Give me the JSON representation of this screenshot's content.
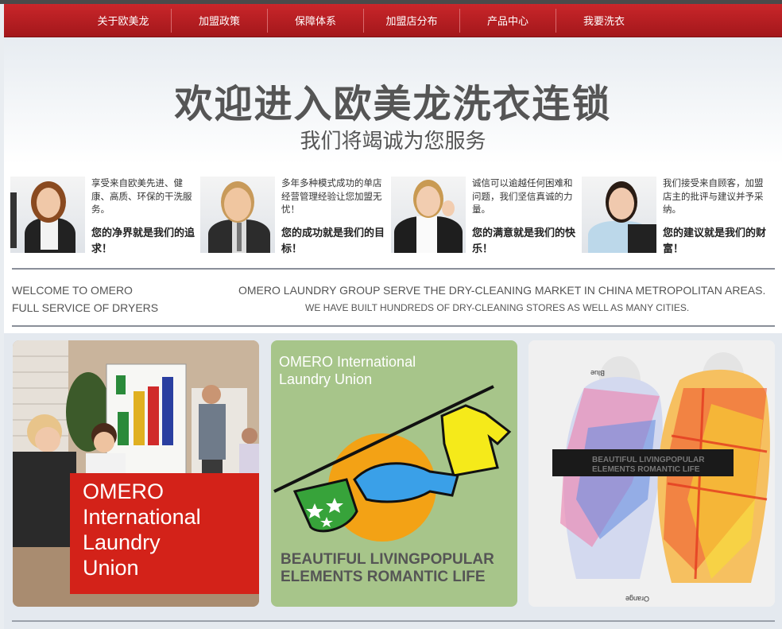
{
  "nav": {
    "items": [
      {
        "label": "关于欧美龙"
      },
      {
        "label": "加盟政策"
      },
      {
        "label": "保障体系"
      },
      {
        "label": "加盟店分布"
      },
      {
        "label": "产品中心"
      },
      {
        "label": "我要洗衣"
      }
    ],
    "color": "#b51e22"
  },
  "hero": {
    "title": "欢迎进入欧美龙洗衣连锁",
    "subtitle": "我们将竭诚为您服务",
    "cards": [
      {
        "text": "享受来自欧美先进、健康、高质、环保的干洗服务。",
        "bold": "您的净界就是我们的追求！"
      },
      {
        "text": "多年多种模式成功的单店经营管理经验让您加盟无忧！",
        "bold": "您的成功就是我们的目标！"
      },
      {
        "text": "诚信可以逾越任何困难和问题，我们坚信真诚的力量。",
        "bold": "您的满意就是我们的快乐！"
      },
      {
        "text": "我们接受来自顾客，加盟店主的批评与建议并予采纳。",
        "bold": "您的建议就是我们的财富！"
      }
    ]
  },
  "welcome": {
    "line1": "WELCOME TO OMERO",
    "line2": "FULL SERVICE OF DRYERS",
    "headline": "OMERO LAUNDRY GROUP SERVE THE DRY-CLEANING MARKET IN CHINA METROPOLITAN AREAS.",
    "subline": "WE HAVE BUILT HUNDREDS OF DRY-CLEANING STORES AS WELL AS MANY CITIES."
  },
  "tiles": {
    "tile1": {
      "line1": "OMERO",
      "line2": "International",
      "line3": "Laundry",
      "line4": "Union"
    },
    "tile2": {
      "title1": "OMERO International",
      "title2": "Laundry Union",
      "slogan1": "BEAUTIFUL LIVINGPOPULAR",
      "slogan2": "ELEMENTS  ROMANTIC LIFE"
    },
    "tile3": {
      "tag1": "BEAUTIFUL LIVINGPOPULAR",
      "tag2": "ELEMENTS  ROMANTIC LIFE",
      "blue": "Blue",
      "orange": "Orange"
    }
  }
}
